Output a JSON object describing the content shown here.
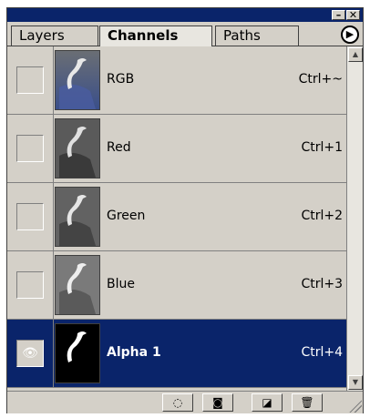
{
  "titlebar": {
    "minimize_label": "–",
    "close_label": "✕"
  },
  "tabs": [
    {
      "label": "Layers",
      "active": false
    },
    {
      "label": "Channels",
      "active": true
    },
    {
      "label": "Paths",
      "active": false
    }
  ],
  "menu_icon": "menu-arrow-icon",
  "channels": [
    {
      "name": "RGB",
      "shortcut": "Ctrl+~",
      "visible": false,
      "selected": false
    },
    {
      "name": "Red",
      "shortcut": "Ctrl+1",
      "visible": false,
      "selected": false
    },
    {
      "name": "Green",
      "shortcut": "Ctrl+2",
      "visible": false,
      "selected": false
    },
    {
      "name": "Blue",
      "shortcut": "Ctrl+3",
      "visible": false,
      "selected": false
    },
    {
      "name": "Alpha 1",
      "shortcut": "Ctrl+4",
      "visible": true,
      "selected": true
    }
  ],
  "bottom_buttons": [
    {
      "icon": "dotted-circle-icon",
      "glyph": "◌"
    },
    {
      "icon": "save-selection-icon",
      "glyph": "◙"
    },
    {
      "icon": "new-channel-icon",
      "glyph": "◪"
    },
    {
      "icon": "trash-icon",
      "glyph": "🗑"
    }
  ],
  "colors": {
    "selection": "#0a246a",
    "panel": "#d4d0c8"
  }
}
